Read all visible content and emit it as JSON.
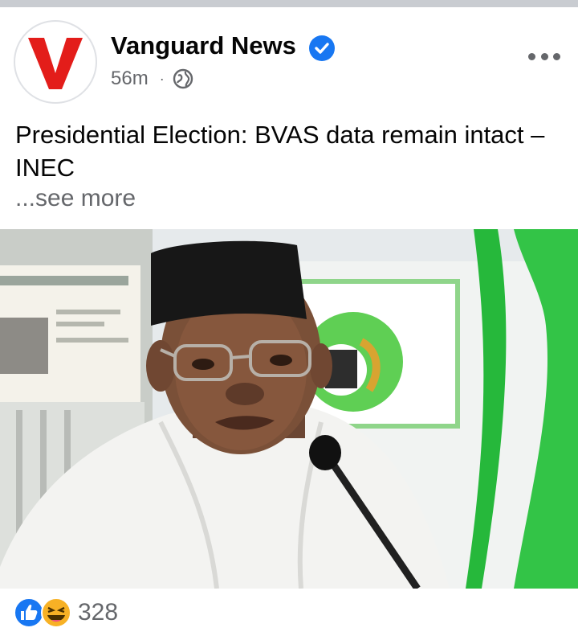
{
  "post": {
    "page_name": "Vanguard News",
    "time": "56m",
    "separator": "·",
    "text": "Presidential Election: BVAS data remain intact – INEC",
    "see_more": "...see more",
    "reaction_count": "328"
  },
  "icons": {
    "avatar": "vanguard-v-logo",
    "verified": "verified-badge-icon",
    "audience": "globe-icon",
    "more": "more-options-icon",
    "reactions": [
      "like-icon",
      "haha-icon"
    ]
  },
  "colors": {
    "brand_red": "#e31d1a",
    "verified_blue": "#1877f2",
    "meta_gray": "#65676b",
    "text": "#050505"
  }
}
